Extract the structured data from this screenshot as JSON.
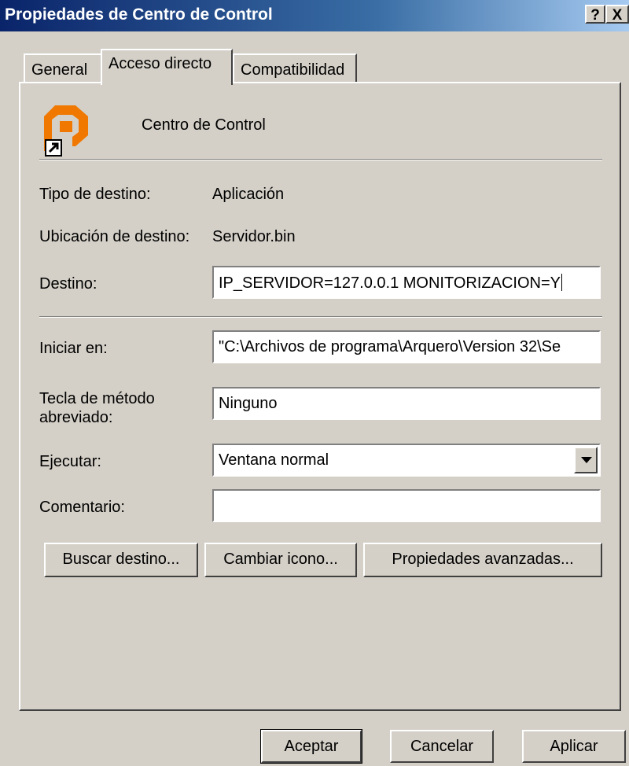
{
  "window": {
    "title": "Propiedades de Centro de Control",
    "help_label": "?",
    "close_label": "X"
  },
  "tabs": [
    {
      "label": "General",
      "active": false
    },
    {
      "label": "Acceso directo",
      "active": true
    },
    {
      "label": "Compatibilidad",
      "active": false
    }
  ],
  "shortcut": {
    "name": "Centro de Control",
    "icon": "orange-p-app-icon",
    "icon_color": "#f07800",
    "target_type_label": "Tipo de destino:",
    "target_type_value": "Aplicación",
    "target_location_label": "Ubicación de destino:",
    "target_location_value": "Servidor.bin",
    "target_label": "Destino:",
    "target_value": "IP_SERVIDOR=127.0.0.1 MONITORIZACION=Y",
    "start_in_label": "Iniciar en:",
    "start_in_value": "\"C:\\Archivos de programa\\Arquero\\Version 32\\Se",
    "hotkey_label_line1": "Tecla de método",
    "hotkey_label_line2": "abreviado:",
    "hotkey_value": "Ninguno",
    "run_label": "Ejecutar:",
    "run_value": "Ventana normal",
    "comment_label": "Comentario:",
    "comment_value": ""
  },
  "panel_buttons": {
    "find_target": "Buscar destino...",
    "change_icon": "Cambiar icono...",
    "advanced": "Propiedades avanzadas..."
  },
  "dialog_buttons": {
    "ok": "Aceptar",
    "cancel": "Cancelar",
    "apply": "Aplicar"
  }
}
